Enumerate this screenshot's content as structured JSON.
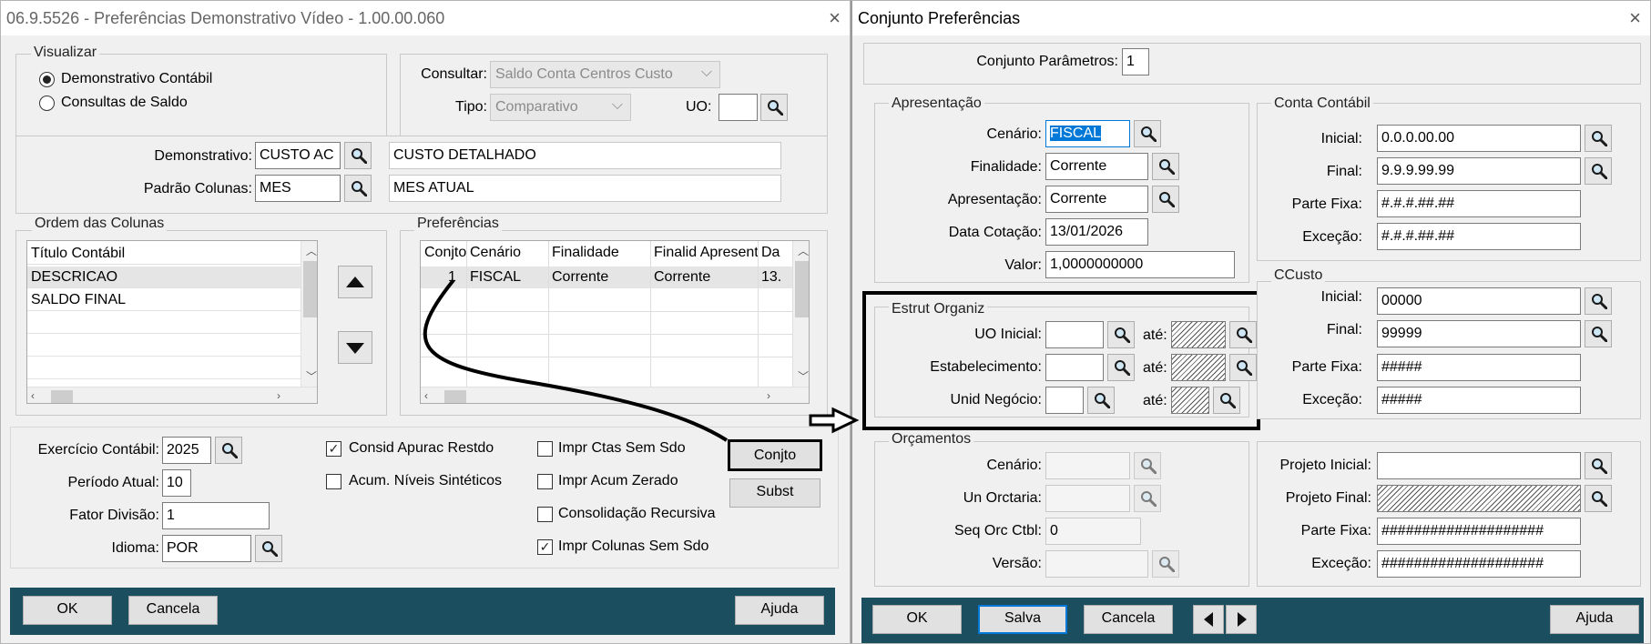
{
  "left": {
    "title": "06.9.5526 - Preferências Demonstrativo Vídeo - 1.00.00.060",
    "close_icon": "×",
    "visualizar": {
      "legend": "Visualizar",
      "opt1": "Demonstrativo Contábil",
      "opt2": "Consultas de Saldo",
      "selected": "Demonstrativo Contábil"
    },
    "consultar_label": "Consultar:",
    "consultar_value": "Saldo Conta Centros Custo",
    "tipo_label": "Tipo:",
    "tipo_value": "Comparativo",
    "uo_label": "UO:",
    "demonstrativo_label": "Demonstrativo:",
    "demonstrativo_code": "CUSTO AC",
    "demonstrativo_desc": "CUSTO DETALHADO",
    "padrao_label": "Padrão Colunas:",
    "padrao_code": "MES",
    "padrao_desc": "MES ATUAL",
    "ordem": {
      "legend": "Ordem das Colunas",
      "header": "Título Contábil",
      "items": [
        "DESCRICAO",
        "SALDO FINAL"
      ]
    },
    "preferencias": {
      "legend": "Preferências",
      "columns": [
        "Conjto",
        "Cenário",
        "Finalidade",
        "Finalid Apresent",
        "Da"
      ],
      "row": [
        "1",
        "FISCAL",
        "Corrente",
        "Corrente",
        "13."
      ]
    },
    "exercicio_label": "Exercício Contábil:",
    "exercicio_value": "2025",
    "periodo_label": "Período Atual:",
    "periodo_value": "10",
    "fator_label": "Fator Divisão:",
    "fator_value": "1",
    "idioma_label": "Idioma:",
    "idioma_value": "POR",
    "checks": {
      "consid": "Consid Apurac Restdo",
      "acum": "Acum. Níveis Sintéticos",
      "impr_ctas": "Impr Ctas Sem Sdo",
      "impr_acum": "Impr Acum Zerado",
      "consol": "Consolidação Recursiva",
      "impr_col": "Impr Colunas Sem Sdo"
    },
    "conjto_button": "Conjto",
    "subst_button": "Subst",
    "ok": "OK",
    "cancela": "Cancela",
    "ajuda": "Ajuda"
  },
  "right": {
    "title": "Conjunto Preferências",
    "close_icon": "×",
    "conjunto_label": "Conjunto Parâmetros:",
    "conjunto_value": "1",
    "apresentacao": {
      "legend": "Apresentação",
      "cenario_label": "Cenário:",
      "cenario_value": "FISCAL",
      "finalidade_label": "Finalidade:",
      "finalidade_value": "Corrente",
      "apresentacao_label": "Apresentação:",
      "apresentacao_value": "Corrente",
      "data_label": "Data Cotação:",
      "data_value": "13/01/2026",
      "valor_label": "Valor:",
      "valor_value": "1,0000000000"
    },
    "conta": {
      "legend": "Conta Contábil",
      "inicial_label": "Inicial:",
      "inicial_value": "0.0.0.00.00",
      "final_label": "Final:",
      "final_value": "9.9.9.99.99",
      "fixa_label": "Parte Fixa:",
      "fixa_value": "#.#.#.##.##",
      "excecao_label": "Exceção:",
      "excecao_value": "#.#.#.##.##"
    },
    "estrut": {
      "legend": "Estrut Organiz",
      "uo_label": "UO Inicial:",
      "estab_label": "Estabelecimento:",
      "unid_label": "Unid Negócio:",
      "ate": "até:"
    },
    "ccusto": {
      "legend": "CCusto",
      "inicial_label": "Inicial:",
      "inicial_value": "00000",
      "final_label": "Final:",
      "final_value": "99999",
      "fixa_label": "Parte Fixa:",
      "fixa_value": "#####",
      "excecao_label": "Exceção:",
      "excecao_value": "#####"
    },
    "orcamentos": {
      "legend": "Orçamentos",
      "cenario_label": "Cenário:",
      "orctaria_label": "Un Orctaria:",
      "seq_label": "Seq Orc Ctbl:",
      "seq_value": "0",
      "versao_label": "Versão:"
    },
    "projeto": {
      "inicial_label": "Projeto Inicial:",
      "final_label": "Projeto Final:",
      "fixa_label": "Parte Fixa:",
      "fixa_value": "####################",
      "excecao_label": "Exceção:",
      "excecao_value": "####################"
    },
    "ok": "OK",
    "salva": "Salva",
    "cancela": "Cancela",
    "ajuda": "Ajuda"
  }
}
